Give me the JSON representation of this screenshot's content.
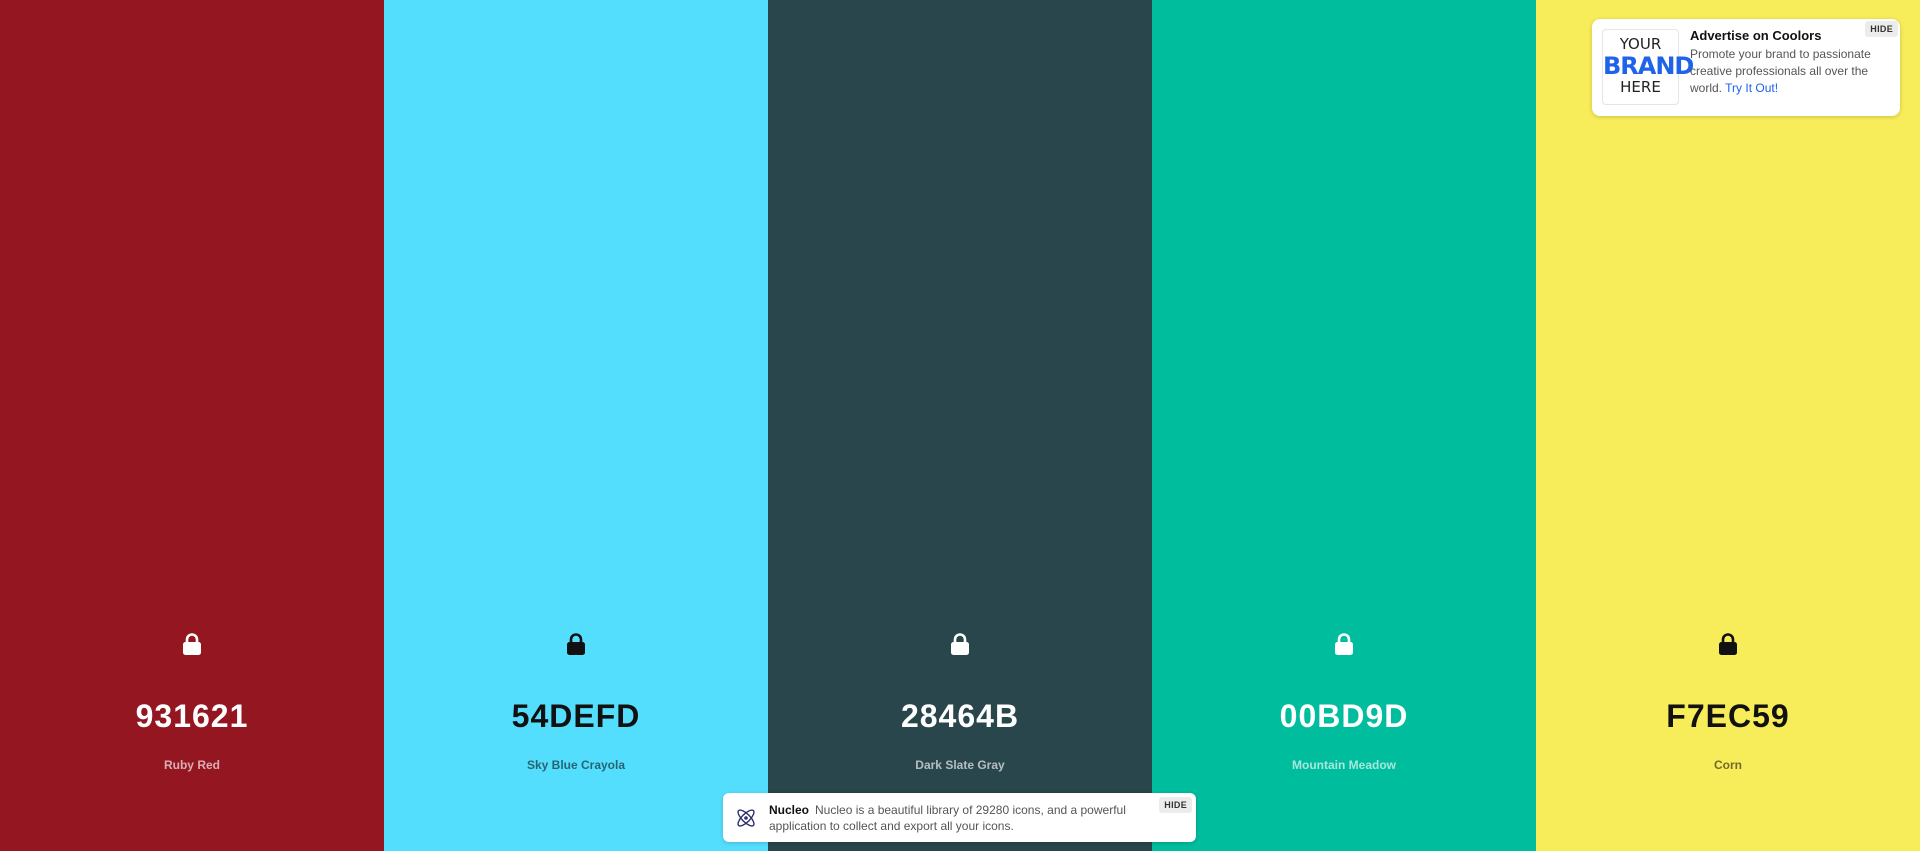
{
  "palette": {
    "colors": [
      {
        "hex": "931621",
        "name": "Ruby Red",
        "color": "#931621",
        "text_theme": "light"
      },
      {
        "hex": "54DEFD",
        "name": "Sky Blue Crayola",
        "color": "#54DEFD",
        "text_theme": "dark"
      },
      {
        "hex": "28464B",
        "name": "Dark Slate Gray",
        "color": "#28464B",
        "text_theme": "light"
      },
      {
        "hex": "00BD9D",
        "name": "Mountain Meadow",
        "color": "#00BD9D",
        "text_theme": "light"
      },
      {
        "hex": "F7EC59",
        "name": "Corn",
        "color": "#F7EC59",
        "text_theme": "dark"
      }
    ],
    "lock_icon": "lock-icon"
  },
  "ad": {
    "brand_line1": "YOUR",
    "brand_line2": "BRAND",
    "brand_line3": "HERE",
    "title": "Advertise on Coolors",
    "body": "Promote your brand to passionate creative professionals all over the world.",
    "link": "Try It Out!",
    "hide_label": "HIDE",
    "link_color": "#1e63e9"
  },
  "promo": {
    "title": "Nucleo",
    "body": "Nucleo is a beautiful library of 29280 icons, and a powerful application to collect and export all your icons.",
    "hide_label": "HIDE",
    "logo_icon": "nucleo-atom-icon"
  }
}
